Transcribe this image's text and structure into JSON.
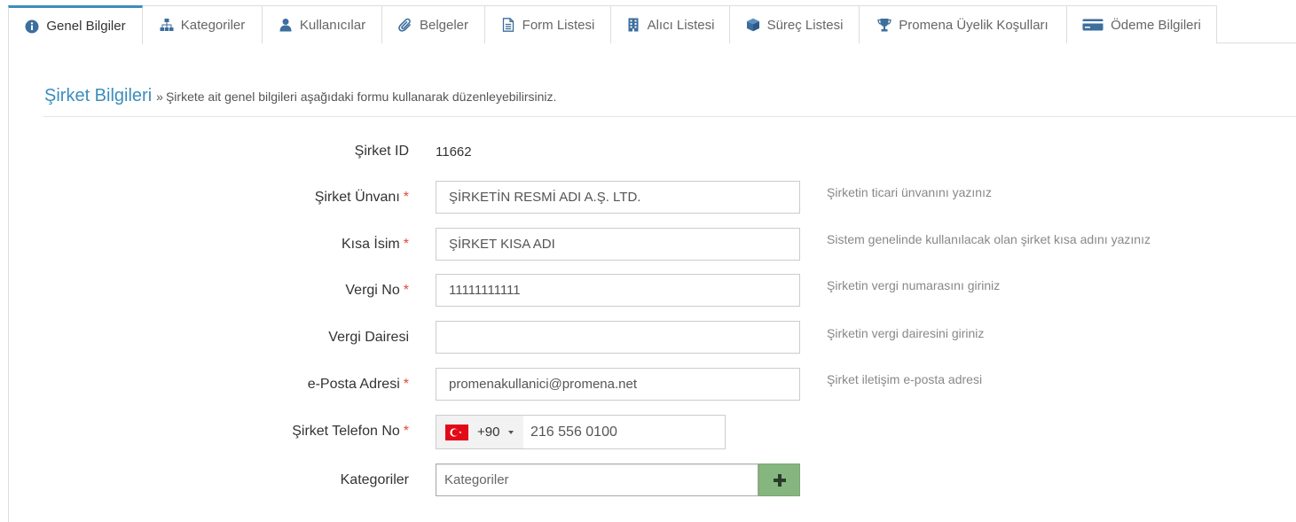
{
  "colors": {
    "accent": "#3c8dbc",
    "required": "#dd4b39",
    "add_button": "#86b67f"
  },
  "tabs": [
    {
      "label": "Genel Bilgiler",
      "icon": "info-circle-icon",
      "active": true
    },
    {
      "label": "Kategoriler",
      "icon": "sitemap-icon",
      "active": false
    },
    {
      "label": "Kullanıcılar",
      "icon": "user-icon",
      "active": false
    },
    {
      "label": "Belgeler",
      "icon": "paperclip-icon",
      "active": false
    },
    {
      "label": "Form Listesi",
      "icon": "file-text-icon",
      "active": false
    },
    {
      "label": "Alıcı Listesi",
      "icon": "building-icon",
      "active": false
    },
    {
      "label": "Süreç Listesi",
      "icon": "cube-icon",
      "active": false
    },
    {
      "label": "Promena Üyelik Koşulları",
      "icon": "trophy-icon",
      "active": false
    },
    {
      "label": "Ödeme Bilgileri",
      "icon": "credit-card-icon",
      "active": false
    }
  ],
  "section": {
    "title": "Şirket Bilgileri",
    "separator": "»",
    "subtitle": "Şirkete ait genel bilgileri aşağıdaki formu kullanarak düzenleyebilirsiniz."
  },
  "form": {
    "required_mark": "*",
    "company_id": {
      "label": "Şirket ID",
      "value": "11662"
    },
    "title": {
      "label": "Şirket Ünvanı",
      "value": "ŞİRKETİN RESMİ ADI A.Ş. LTD.",
      "help": "Şirketin ticari ünvanını yazınız"
    },
    "short_name": {
      "label": "Kısa İsim",
      "value": "ŞİRKET KISA ADI",
      "help": "Sistem genelinde kullanılacak olan şirket kısa adını yazınız"
    },
    "tax_no": {
      "label": "Vergi No",
      "value": "11111111111",
      "help": "Şirketin vergi numarasını giriniz"
    },
    "tax_office": {
      "label": "Vergi Dairesi",
      "value": "",
      "help": "Şirketin vergi dairesini giriniz"
    },
    "email": {
      "label": "e-Posta Adresi",
      "value": "promenakullanici@promena.net",
      "help": "Şirket iletişim e-posta adresi"
    },
    "phone": {
      "label": "Şirket Telefon No",
      "country_flag": "turkey-flag-icon",
      "dial_code": "+90",
      "number": "216 556 0100"
    },
    "categories": {
      "label": "Kategoriler",
      "placeholder": "Kategoriler",
      "add_icon": "plus-icon"
    }
  }
}
